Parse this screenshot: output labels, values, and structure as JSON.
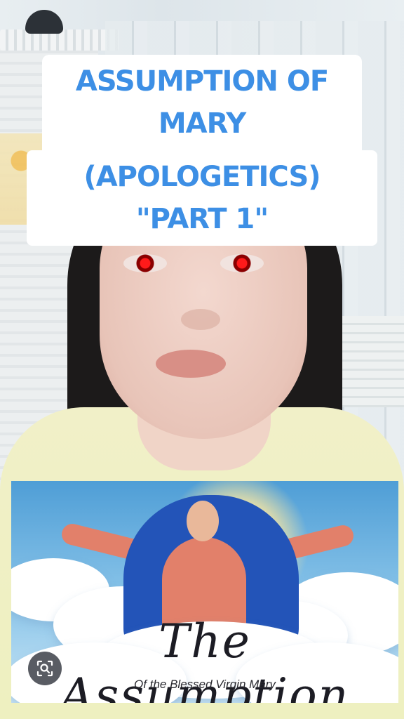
{
  "overlay": {
    "title_line1": "ASSUMPTION OF MARY",
    "title_line2": "(APOLOGETICS) \"PART 1\"",
    "title_color": "#3d8fe5"
  },
  "image_card": {
    "script_title": "The Assumption",
    "subtitle": "Of the Blessed Virgin Mary"
  },
  "lens_button": {
    "icon": "lens-search-icon"
  },
  "colors": {
    "eyes_red": "#ff1a1a",
    "shirt": "#eef0c0",
    "veil_blue": "#2354b8"
  }
}
